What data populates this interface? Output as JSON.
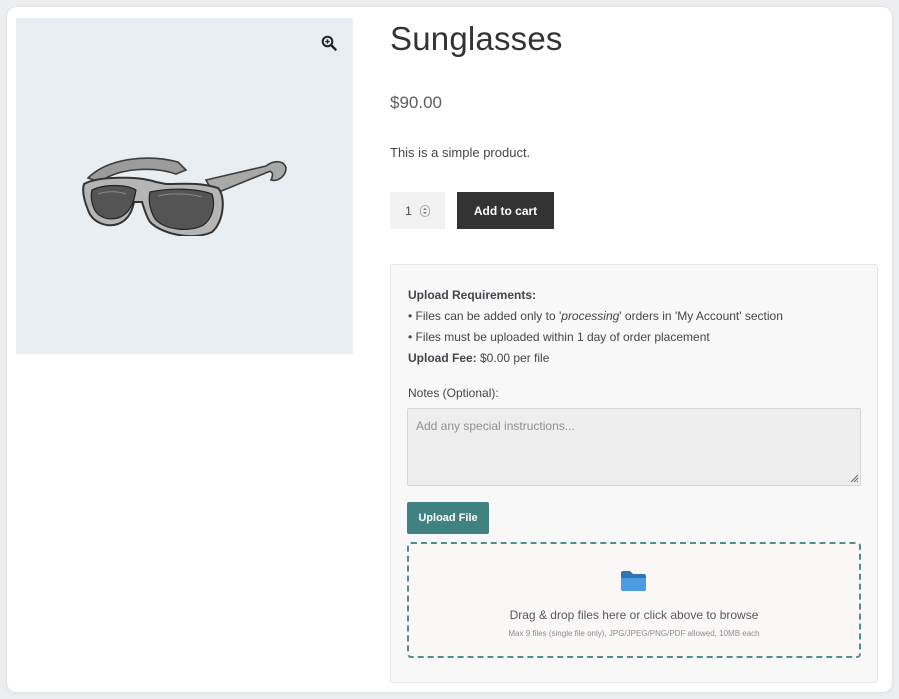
{
  "product": {
    "title": "Sunglasses",
    "price": "$90.00",
    "description": "This is a simple product.",
    "image_icon": "sunglasses-image",
    "zoom_icon": "zoom-in-icon"
  },
  "cart": {
    "quantity": "1",
    "add_label": "Add to cart"
  },
  "upload": {
    "requirements_heading": "Upload Requirements:",
    "rule1_prefix": "• Files can be added only to '",
    "rule1_em": "processing",
    "rule1_suffix": "' orders in 'My Account' section",
    "rule2": "• Files must be uploaded within 1 day of order placement",
    "fee_label": "Upload Fee:",
    "fee_value": " $0.00 per file",
    "notes_label": "Notes (Optional):",
    "notes_placeholder": "Add any special instructions...",
    "notes_value": "",
    "button_label": "Upload File",
    "dropzone_main": "Drag & drop files here or click above to browse",
    "dropzone_sub": "Max 9 files (single file only), JPG/JPEG/PNG/PDF allowed, 10MB each",
    "folder_icon": "folder-icon"
  },
  "colors": {
    "accent": "#3f8281",
    "button_dark": "#333333",
    "gallery_bg": "#e9eef2",
    "folder": "#3b82c4"
  }
}
